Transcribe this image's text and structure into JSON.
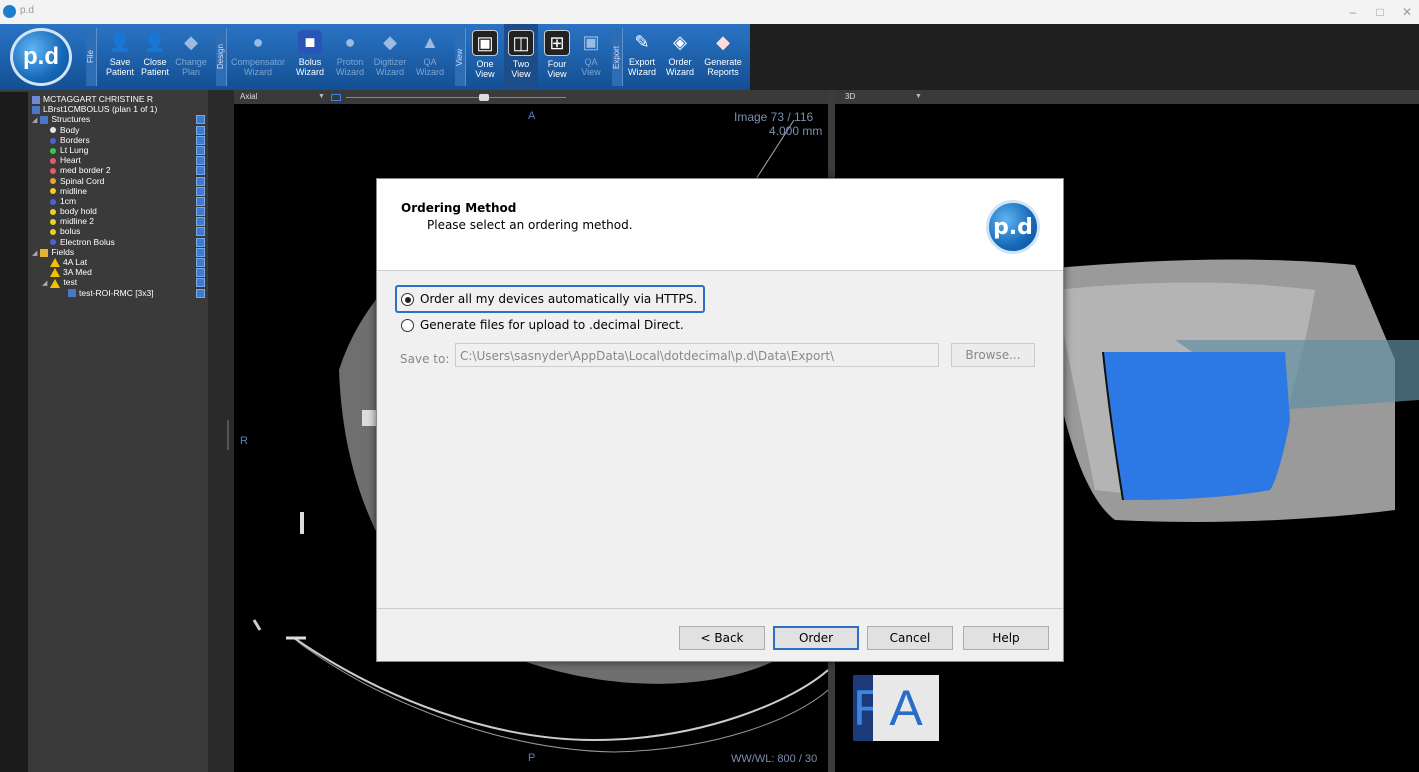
{
  "window": {
    "title": "p.d",
    "minimize": "–",
    "maximize": "□",
    "close": "✕"
  },
  "ribbon": {
    "logo": "p.d",
    "sections": {
      "file": "File",
      "design": "Design",
      "view": "View",
      "export": "Export"
    },
    "buttons": [
      {
        "label": "Save\nPatient",
        "enabled": true
      },
      {
        "label": "Close\nPatient",
        "enabled": true
      },
      {
        "label": "Change\nPlan",
        "enabled": false
      },
      {
        "label": "Compensator\nWizard",
        "enabled": false
      },
      {
        "label": "Bolus\nWizard",
        "enabled": true
      },
      {
        "label": "Proton\nWizard",
        "enabled": false
      },
      {
        "label": "Digitizer\nWizard",
        "enabled": false
      },
      {
        "label": "QA\nWizard",
        "enabled": false
      },
      {
        "label": "One\nView",
        "enabled": true
      },
      {
        "label": "Two\nView",
        "enabled": true
      },
      {
        "label": "Four\nView",
        "enabled": true
      },
      {
        "label": "QA\nView",
        "enabled": false
      },
      {
        "label": "Export\nWizard",
        "enabled": true
      },
      {
        "label": "Order\nWizard",
        "enabled": true
      },
      {
        "label": "Generate\nReports",
        "enabled": true
      }
    ]
  },
  "tree": {
    "patient": "MCTAGGART CHRISTINE R",
    "plan": "LBrst1CMBOLUS (plan 1 of 1)",
    "structures_label": "Structures",
    "structures": [
      {
        "name": "Body",
        "color": "#e8e8e8"
      },
      {
        "name": "Borders",
        "color": "#4a62d8"
      },
      {
        "name": "Lt Lung",
        "color": "#3cc83c"
      },
      {
        "name": "Heart",
        "color": "#e65a6a"
      },
      {
        "name": "med border 2",
        "color": "#e65a6a"
      },
      {
        "name": "Spinal Cord",
        "color": "#f0a030"
      },
      {
        "name": "midline",
        "color": "#f0d020"
      },
      {
        "name": "1cm",
        "color": "#4a62d8"
      },
      {
        "name": "body hold",
        "color": "#f0d020"
      },
      {
        "name": "midline 2",
        "color": "#f0d020"
      },
      {
        "name": "bolus",
        "color": "#f0d020"
      },
      {
        "name": "Electron Bolus",
        "color": "#4a62d8"
      }
    ],
    "fields_label": "Fields",
    "fields": [
      "4A Lat",
      "3A Med",
      "test"
    ],
    "subfield": "test-ROI-RMC [3x3]"
  },
  "left_view": {
    "mode": "Axial",
    "top_label": "A",
    "left_label": "R",
    "bottom_label": "P",
    "image_info": "Image 73 / 116",
    "slice_thickness": "4.000 mm",
    "window_level": "WW/WL: 800 / 30"
  },
  "right_view": {
    "mode": "3D",
    "orientation_r": "R",
    "orientation_a": "A"
  },
  "dialog": {
    "title": "Ordering Method",
    "subtitle": "Please select an ordering method.",
    "logo": "p.d",
    "option1": "Order all my devices automatically via HTTPS.",
    "option2": "Generate files for upload to .decimal Direct.",
    "save_label": "Save to:",
    "save_path": "C:\\Users\\sasnyder\\AppData\\Local\\dotdecimal\\p.d\\Data\\Export\\",
    "browse": "Browse...",
    "back": "< Back",
    "order": "Order",
    "cancel": "Cancel",
    "help": "Help"
  }
}
